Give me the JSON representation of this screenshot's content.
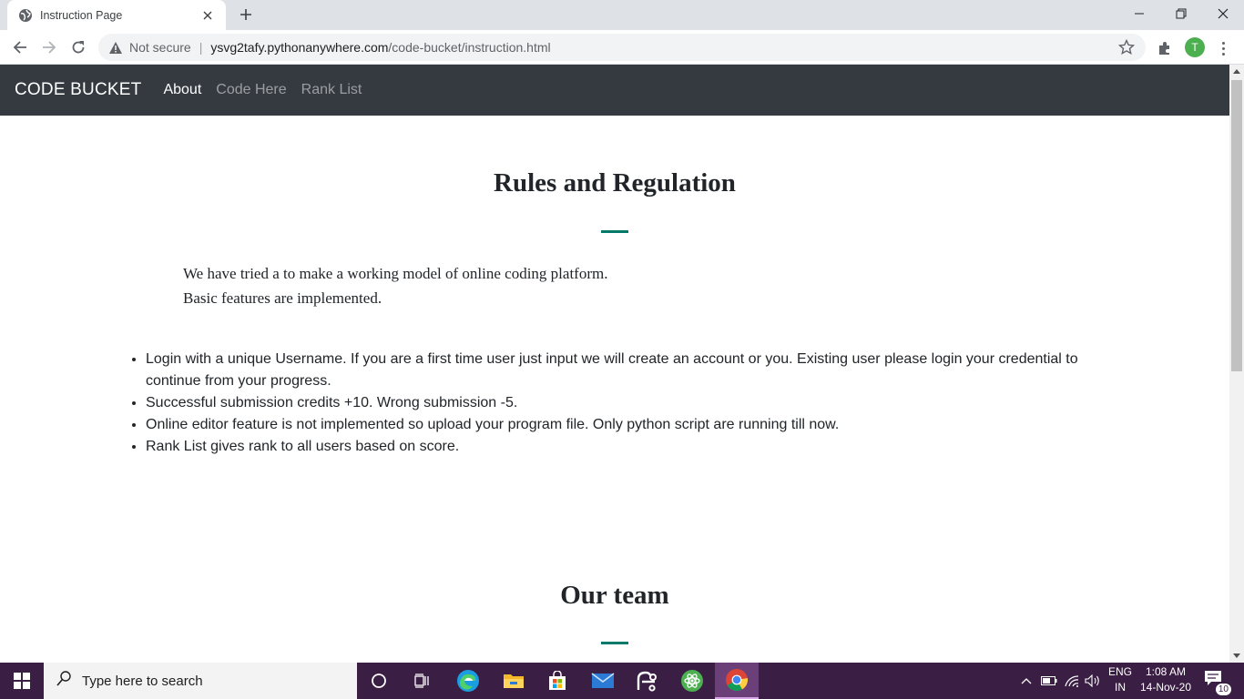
{
  "browser": {
    "tab_title": "Instruction Page",
    "security_label": "Not secure",
    "url_host": "ysvg2tafy.pythonanywhere.com",
    "url_path": "/code-bucket/instruction.html",
    "profile_initial": "T"
  },
  "site": {
    "brand": "CODE BUCKET",
    "nav": [
      "About",
      "Code Here",
      "Rank List"
    ]
  },
  "content": {
    "rules_heading": "Rules and Regulation",
    "intro_line1": "We have tried a to make a working model of online coding platform.",
    "intro_line2": "Basic features are implemented.",
    "rules": [
      "Login with a unique Username. If you are a first time user just input we will create an account or you. Existing user please login your credential to continue from your progress.",
      "Successful submission credits +10. Wrong submission -5.",
      "Online editor feature is not implemented so upload your program file. Only python script are running till now.",
      "Rank List gives rank to all users based on score."
    ],
    "team_heading": "Our team"
  },
  "taskbar": {
    "search_placeholder": "Type here to search",
    "lang_line1": "ENG",
    "lang_line2": "IN",
    "time": "1:08 AM",
    "date": "14-Nov-20",
    "notification_count": "10"
  },
  "colors": {
    "navbar": "#343a40",
    "accent_divider": "#00796b",
    "taskbar": "#3b1e44"
  }
}
